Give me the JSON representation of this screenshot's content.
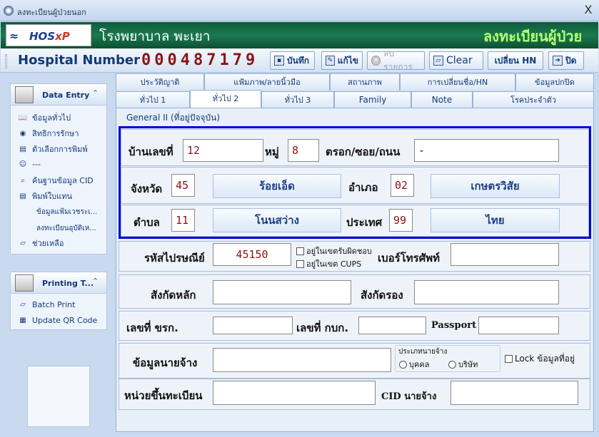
{
  "window": {
    "title": "ลงทะเบียนผู้ป่วยนอก",
    "close": "X"
  },
  "header": {
    "logo_wave": "≈",
    "logo_text_a": "HOS",
    "logo_text_b": "xP",
    "hospital_name": "โรงพยาบาล พะเยา",
    "title": "ลงทะเบียนผู้ป่วย"
  },
  "toolbar": {
    "hn_label": "Hospital Number",
    "hn_value": "000487179",
    "buttons": {
      "save": "บันทึก",
      "edit": "แก้ไข",
      "delete": "ลบรายการ",
      "clear": "Clear",
      "change_hn": "เปลี่ยน HN",
      "close": "ปิด"
    }
  },
  "nav": {
    "data_entry_title": "Data Entry",
    "items": [
      "ข้อมูลทั่วไป",
      "สิทธิการรักษา",
      "ตัวเลือกการพิมพ์",
      "---",
      "ค้นฐานข้อมูล CID",
      "พิมพ์ใบแทน",
      "ข้อมูลแฟ้มเวชระเ...",
      "ลงทะเบียนอุบัติเห...",
      "ช่วยเหลือ"
    ],
    "printing_title": "Printing T...",
    "print_items": [
      "Batch Print",
      "Update QR Code"
    ]
  },
  "tabs": {
    "row1": [
      "ประวัติญาติ",
      "แฟ้มภาพ/ลายนิ้วมือ",
      "สถานภาพ",
      "การเปลี่ยนชื่อ/HN",
      "ข้อมูลปกปิด"
    ],
    "row2": [
      "ทั่วไป 1",
      "ทั่วไป 2",
      "ทั่วไป 3",
      "Family",
      "Note",
      "โรคประจำตัว"
    ]
  },
  "form": {
    "group_caption": "General II (ที่อยู่ปัจจุบัน)",
    "house_no_label": "บ้านเลขที่",
    "house_no": "12",
    "moo_label": "หมู่",
    "moo": "8",
    "road_label": "ตรอก/ซอย/ถนน",
    "road": "-",
    "province_label": "จังหวัด",
    "province_code": "45",
    "province_name": "ร้อยเอ็ด",
    "amphur_label": "อำเภอ",
    "amphur_code": "02",
    "amphur_name": "เกษตรวิสัย",
    "tambon_label": "ตำบล",
    "tambon_code": "11",
    "tambon_name": "โนนสว่าง",
    "country_label": "ประเทศ",
    "country_code": "99",
    "country_name": "ไทย",
    "postcode_label": "รหัสไปรษณีย์",
    "postcode": "45150",
    "in_area_label": "อยู่ในเขตรับผิดชอบ",
    "in_cups_label": "อยู่ในเขต CUPS",
    "phone_label": "เบอร์โทรศัพท์",
    "phone": "",
    "main_affil_label": "สังกัดหลัก",
    "main_affil": "",
    "sub_affil_label": "สังกัดรอง",
    "sub_affil": "",
    "civil_no_label": "เลขที่ ขรก.",
    "civil_no": "",
    "kbk_no_label": "เลขที่ กบก.",
    "kbk_no": "",
    "passport_label": "Passport",
    "passport": "",
    "employer_label": "ข้อมูลนายจ้าง",
    "employer": "",
    "employer_type_label": "ประเภทนายจ้าง",
    "person_label": "บุคคล",
    "company_label": "บริษัท",
    "lock_label": "Lock ข้อมูลที่อยู่",
    "reg_unit_label": "หน่วยขึ้นทะเบียน",
    "reg_unit": "",
    "employer_cid_label": "CID นายจ้าง",
    "employer_cid": ""
  }
}
